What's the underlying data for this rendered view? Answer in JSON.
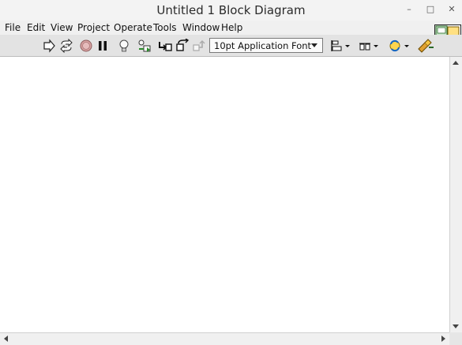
{
  "window": {
    "title": "Untitled 1 Block Diagram",
    "controls": {
      "minimize": "–",
      "maximize": "□",
      "close": "✕"
    }
  },
  "menu": {
    "items": [
      "File",
      "Edit",
      "View",
      "Project",
      "Operate",
      "Tools",
      "Window",
      "Help"
    ]
  },
  "toolbar": {
    "buttons": [
      "run-arrow-icon",
      "run-continuously-icon",
      "abort-icon",
      "pause-icon",
      "highlight-execution-icon",
      "retain-wire-values-icon",
      "step-into-icon",
      "step-over-icon",
      "step-out-icon",
      "align-objects-icon",
      "distribute-objects-icon",
      "reorder-icon",
      "clean-up-diagram-icon"
    ],
    "font_selector": {
      "value": "10pt Application Font"
    }
  },
  "vi_icon": {
    "number": "1"
  },
  "colors": {
    "canvas": "#ffffff",
    "toolbar": "#e3e3e3",
    "accent_green": "#3a8a3a"
  }
}
